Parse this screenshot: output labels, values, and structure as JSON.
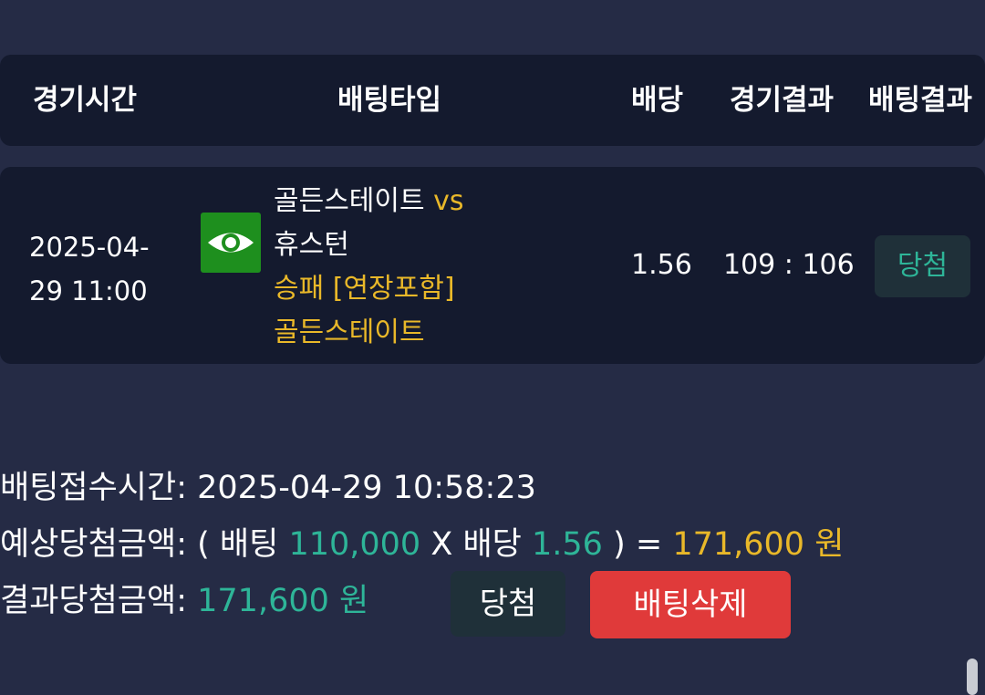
{
  "header": {
    "col_time": "경기시간",
    "col_bet_type": "배팅타입",
    "col_odds": "배당",
    "col_game_result": "경기결과",
    "col_bet_result": "배팅결과"
  },
  "bet": {
    "time_line1": "2025-04-",
    "time_line2": "29 11:00",
    "icon": "eye-icon",
    "home_team": "골든스테이트",
    "vs": "vs",
    "away_team": "휴스턴",
    "bet_type": "승패 [연장포함]",
    "pick": "골든스테이트",
    "odds": "1.56",
    "score": "109 : 106",
    "result": "당첨"
  },
  "summary": {
    "receipt_label": "배팅접수시간:",
    "receipt_time": "2025-04-29 10:58:23",
    "expected_label": "예상당첨금액:",
    "open_paren": "( 배팅",
    "stake": "110,000",
    "x_odds_label": "X 배당",
    "odds": "1.56",
    "close_eq": ") =",
    "expected_amount": "171,600 원",
    "result_label": "결과당첨금액:",
    "result_amount": "171,600 원"
  },
  "buttons": {
    "win": "당첨",
    "delete": "배팅삭제"
  },
  "colors": {
    "background": "#252b45",
    "panel": "#141a2e",
    "green": "#2eb598",
    "gold": "#e9b829",
    "danger": "#e03a3a",
    "eye_icon_bg": "#1e8f1e"
  }
}
